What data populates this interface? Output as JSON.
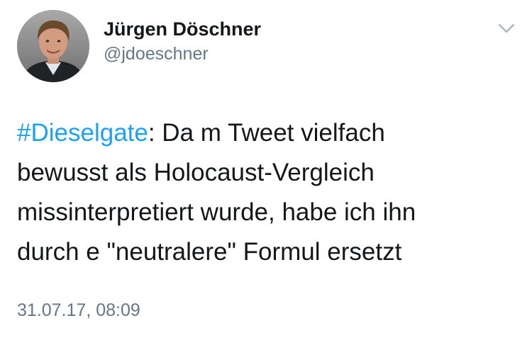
{
  "author": {
    "name": "Jürgen Döschner",
    "handle": "@jdoeschner"
  },
  "tweet": {
    "hashtag": "#Dieselgate",
    "line1_rest": ": Da m Tweet vielfach",
    "line2": "bewusst als Holocaust-Vergleich",
    "line3": "missinterpretiert wurde, habe ich ihn",
    "line4": "durch e \"neutralere\" Formul ersetzt"
  },
  "meta": {
    "timestamp": "31.07.17, 08:09"
  },
  "icons": {
    "more": "chevron-down-icon",
    "avatar": "profile-photo"
  },
  "colors": {
    "link": "#1da1f2",
    "text": "#14171a",
    "secondary": "#657786",
    "chevron": "#aab8c2"
  }
}
